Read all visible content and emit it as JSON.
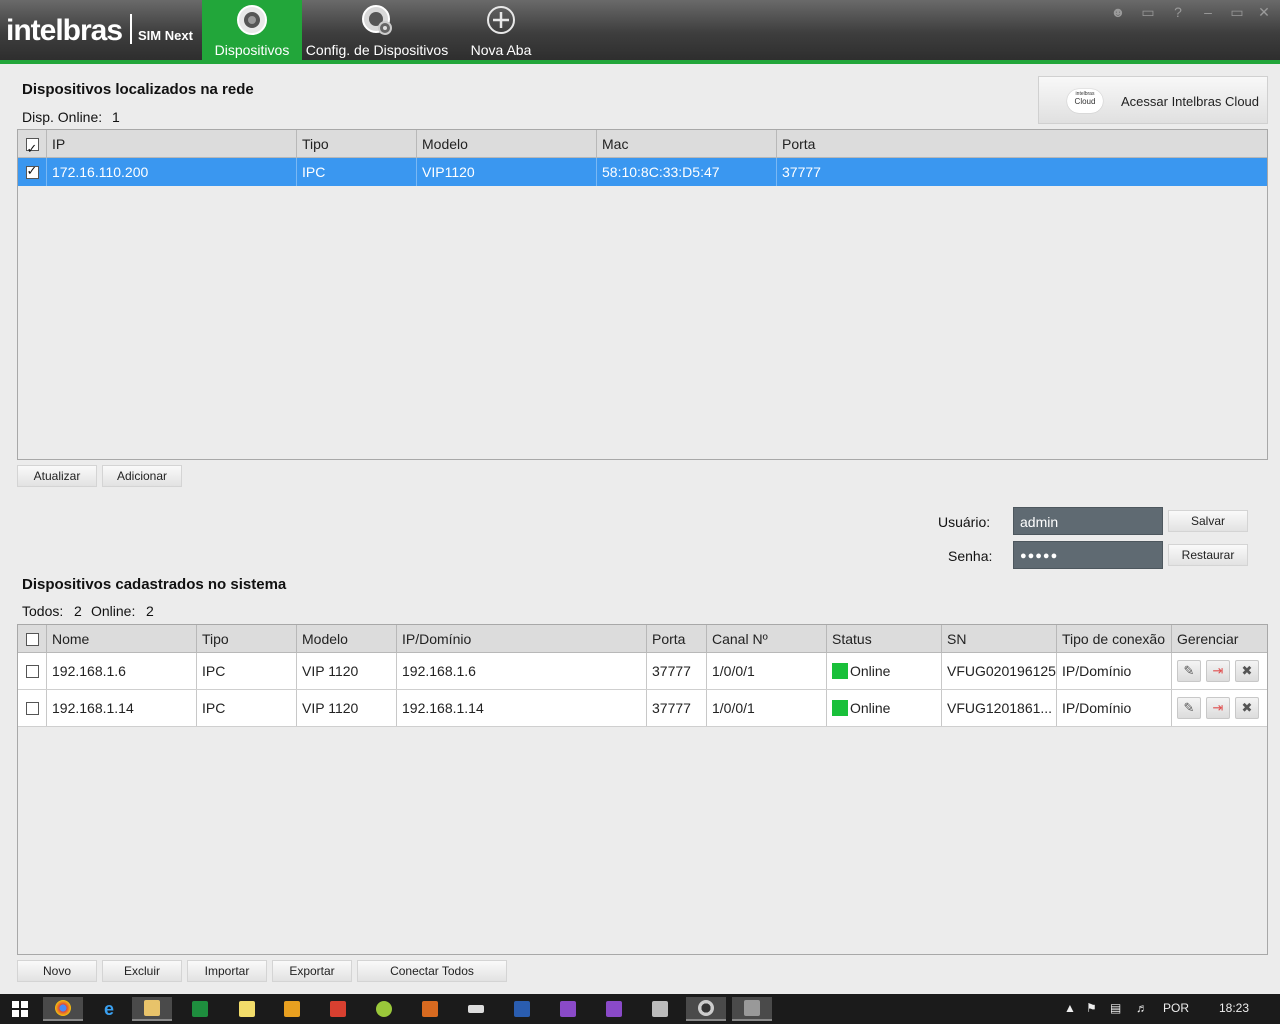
{
  "app": {
    "logo": "intelbras",
    "product": "SIM Next"
  },
  "tabs": [
    {
      "label": "Dispositivos",
      "active": true,
      "icon": "camera-icon"
    },
    {
      "label": "Config. de Dispositivos",
      "active": false,
      "icon": "camera-gear-icon"
    },
    {
      "label": "Nova Aba",
      "active": false,
      "icon": "plus-circle-icon"
    }
  ],
  "window_controls": [
    "user-icon",
    "lock-icon",
    "help-icon",
    "minimize-icon",
    "maximize-icon",
    "close-icon"
  ],
  "network": {
    "title": "Dispositivos localizados na rede",
    "online_label": "Disp. Online:",
    "online_count": "1",
    "columns": [
      "IP",
      "Tipo",
      "Modelo",
      "Mac",
      "Porta"
    ],
    "rows": [
      {
        "ip": "172.16.110.200",
        "tipo": "IPC",
        "modelo": "VIP1120",
        "mac": "58:10:8C:33:D5:47",
        "porta": "37777",
        "checked": true
      }
    ],
    "buttons": {
      "refresh": "Atualizar",
      "add": "Adicionar"
    }
  },
  "cloud": {
    "icon_text_top": "intelbras",
    "icon_text": "Cloud",
    "label": "Acessar Intelbras Cloud"
  },
  "credentials": {
    "user_label": "Usuário:",
    "user_value": "admin",
    "password_label": "Senha:",
    "password_value": "●●●●●",
    "save": "Salvar",
    "restore": "Restaurar"
  },
  "registered": {
    "title": "Dispositivos cadastrados no sistema",
    "all_label": "Todos:",
    "all_count": "2",
    "online_label": "Online:",
    "online_count": "2",
    "columns": [
      "Nome",
      "Tipo",
      "Modelo",
      "IP/Domínio",
      "Porta",
      "Canal Nº",
      "Status",
      "SN",
      "Tipo de conexão",
      "Gerenciar"
    ],
    "rows": [
      {
        "nome": "192.168.1.6",
        "tipo": "IPC",
        "modelo": "VIP 1120",
        "ip": "192.168.1.6",
        "porta": "37777",
        "canal": "1/0/0/1",
        "status": "Online",
        "sn": "VFUG020196125",
        "conexao": "IP/Domínio"
      },
      {
        "nome": "192.168.1.14",
        "tipo": "IPC",
        "modelo": "VIP 1120",
        "ip": "192.168.1.14",
        "porta": "37777",
        "canal": "1/0/0/1",
        "status": "Online",
        "sn": "VFUG1201861...",
        "conexao": "IP/Domínio"
      }
    ],
    "buttons": {
      "new": "Novo",
      "delete": "Excluir",
      "import": "Importar",
      "export": "Exportar",
      "connect_all": "Conectar Todos"
    }
  },
  "colors": {
    "accent": "#22a63a",
    "selection": "#3a97f0",
    "online": "#19c03a"
  },
  "taskbar": {
    "items": [
      "windows-start-icon",
      "chrome-icon",
      "ie-icon",
      "explorer-icon",
      "excel-icon",
      "notes-icon",
      "h-app-icon",
      "media-icon",
      "android-icon",
      "presentation-icon",
      "usb-icon",
      "word-icon",
      "i-app-icon",
      "i-app-icon",
      "printer-icon",
      "sim-next-icon",
      "network-app-icon"
    ],
    "lang": "POR",
    "time": "18:23"
  }
}
